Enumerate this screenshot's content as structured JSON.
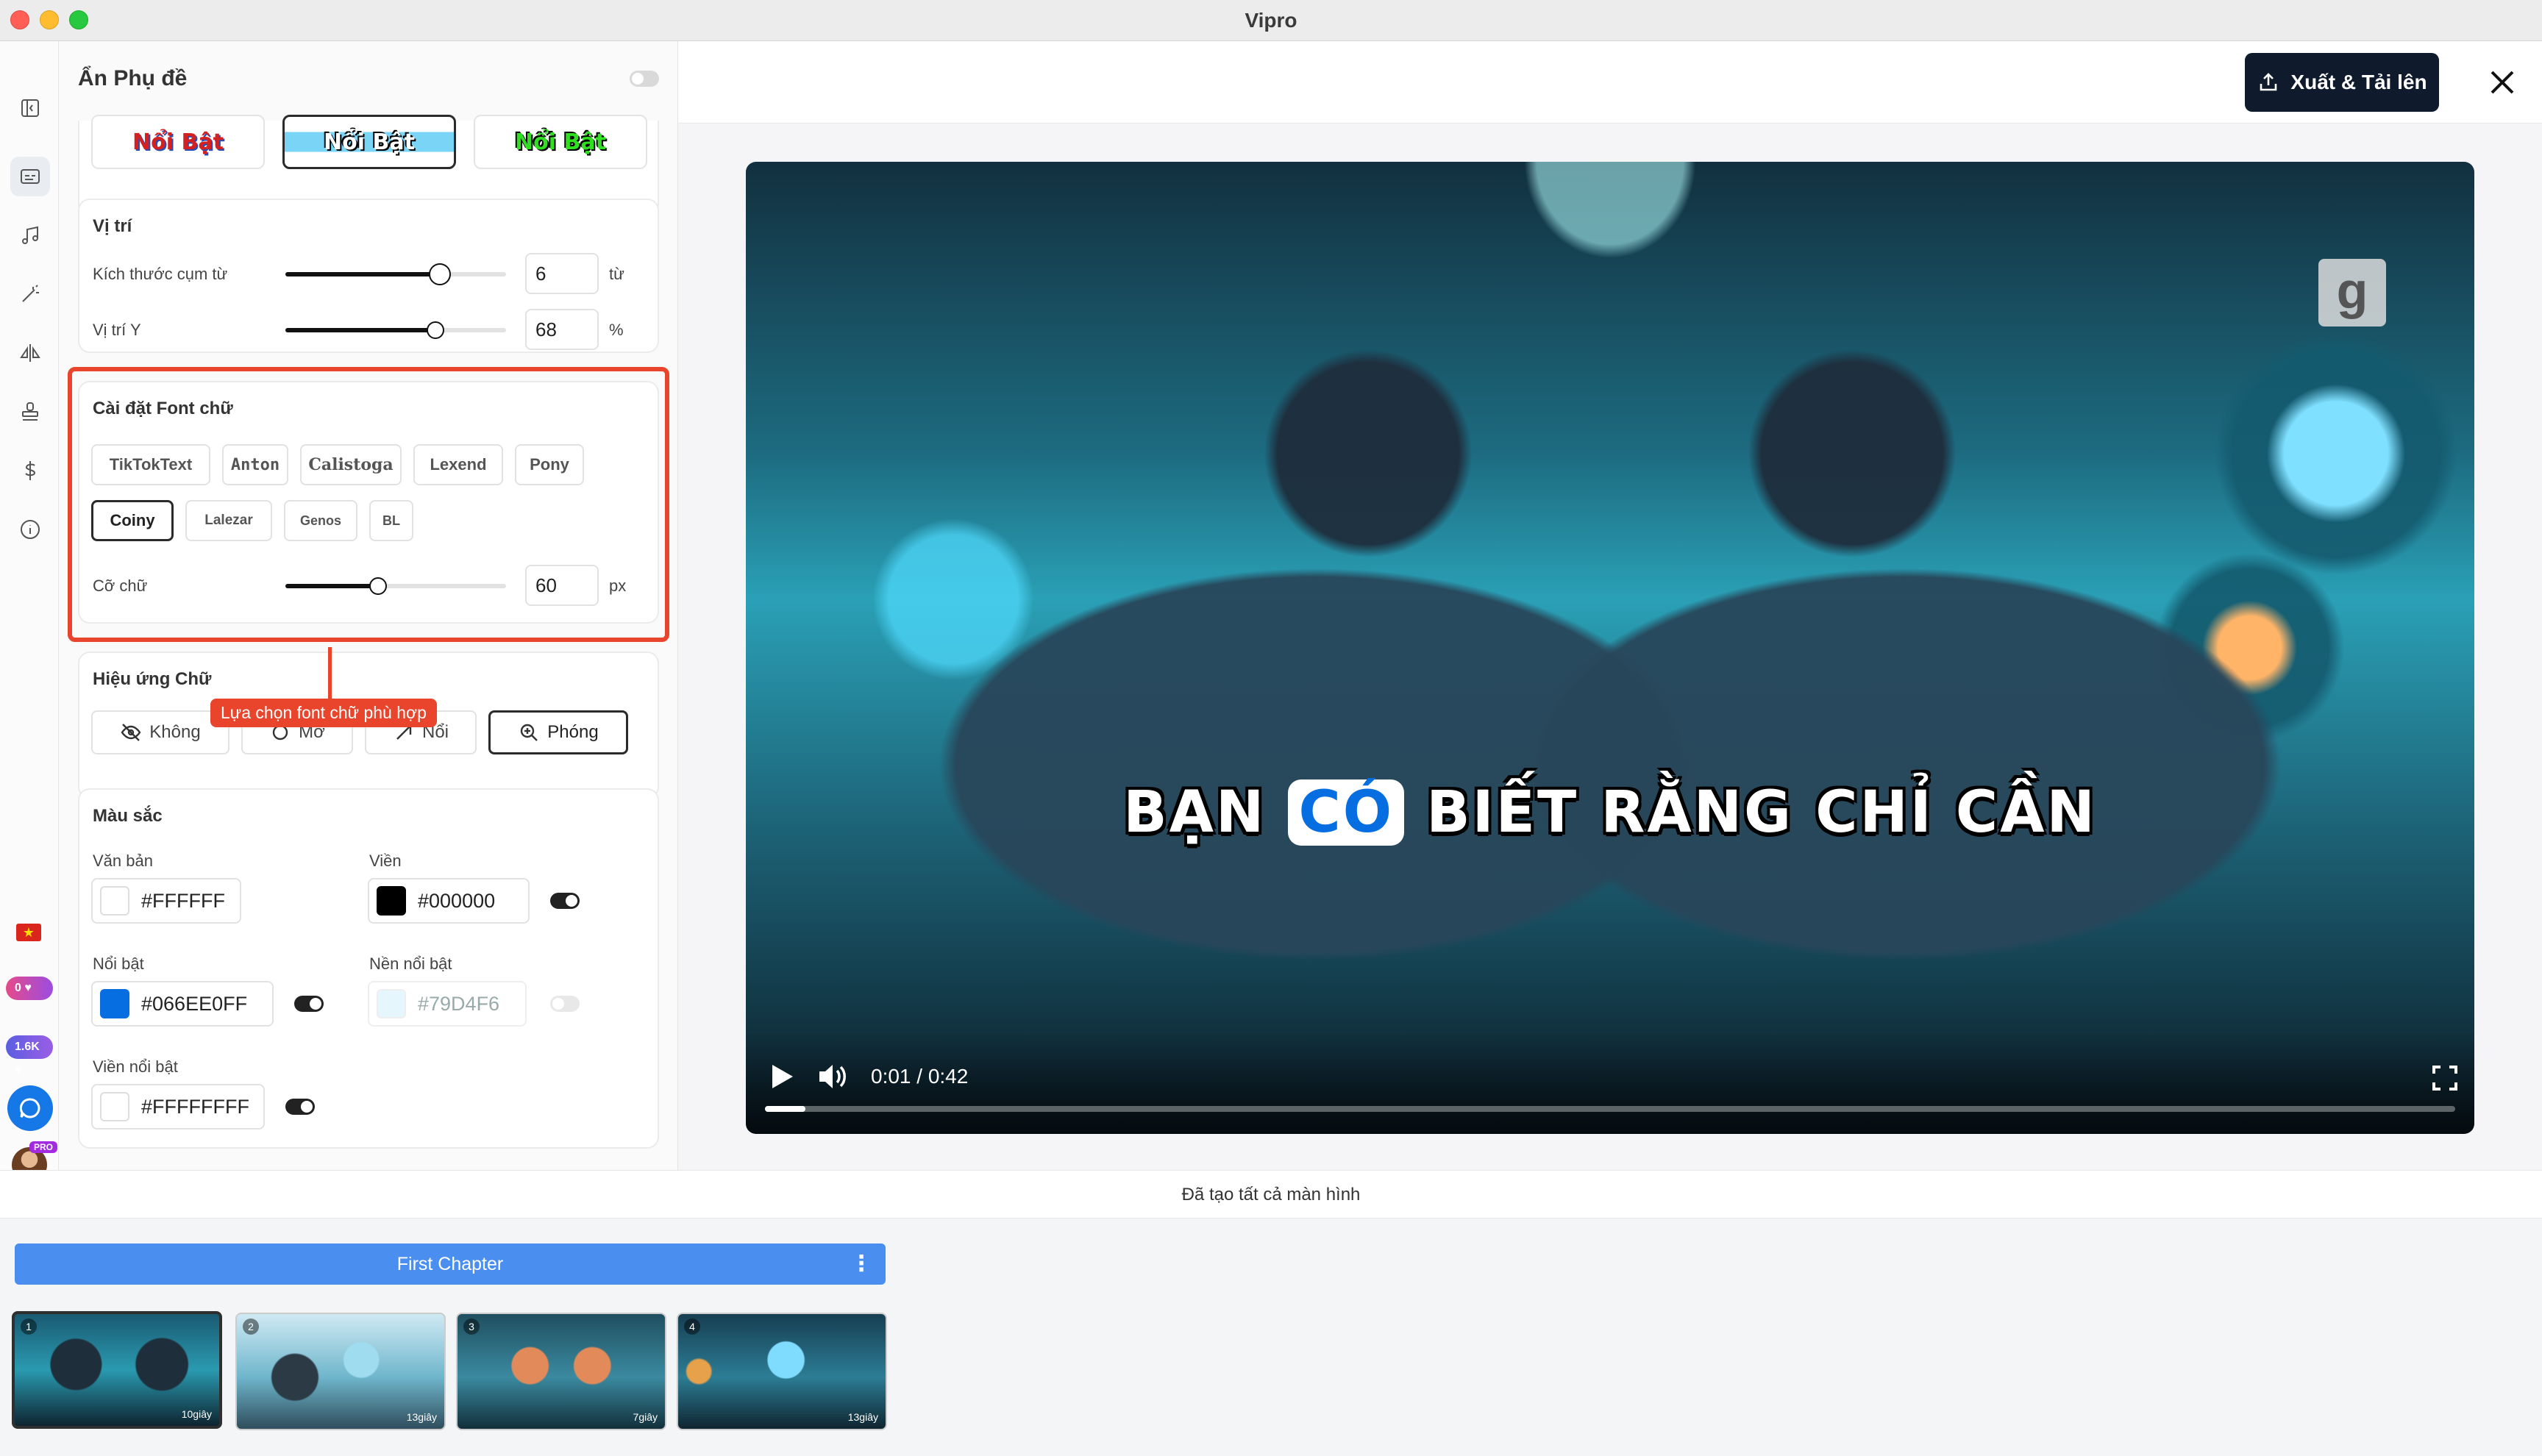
{
  "app": {
    "title": "Vipro"
  },
  "rail": {
    "badge_points": "0",
    "badge_followers": "1.6K",
    "avatar_tag": "PRO"
  },
  "panel": {
    "hide_subtitle_label": "Ẩn Phụ đề",
    "style_presets": [
      "Nổi Bật",
      "Nổi Bật",
      "Nổi Bật"
    ],
    "style_preset_selected": 1,
    "position": {
      "title": "Vị trí",
      "phrase_size_label": "Kích thước cụm từ",
      "phrase_size_value": "6",
      "phrase_size_unit": "từ",
      "phrase_size_fraction": 0.7,
      "pos_y_label": "Vị trí Y",
      "pos_y_value": "68",
      "pos_y_unit": "%",
      "pos_y_fraction": 0.68
    },
    "font": {
      "title": "Cài đặt Font chữ",
      "fonts": [
        "TikTokText",
        "Anton",
        "Calistoga",
        "Lexend",
        "Pony",
        "Coiny",
        "Lalezar",
        "Genos",
        "BL"
      ],
      "selected": "Coiny",
      "size_label": "Cỡ chữ",
      "size_value": "60",
      "size_unit": "px",
      "size_fraction": 0.42
    },
    "callout": "Lựa chọn font chữ phù hợp",
    "effects": {
      "title": "Hiệu ứng Chữ",
      "buttons": [
        "Không",
        "Mờ",
        "Nổi",
        "Phóng"
      ],
      "selected": "Phóng"
    },
    "colors": {
      "title": "Màu sắc",
      "text_label": "Văn bản",
      "text_value": "#FFFFFF",
      "border_label": "Viền",
      "border_value": "#000000",
      "highlight_label": "Nổi bật",
      "highlight_value": "#066EE0FF",
      "highlight_bg_label": "Nền nổi bật",
      "highlight_bg_value": "#79D4F6",
      "highlight_border_label": "Viền nổi bật",
      "highlight_border_value": "#FFFFFFFF"
    }
  },
  "preview": {
    "export_label": "Xuất & Tải lên",
    "subtitle_words": [
      "BẠN",
      "CÓ",
      "BIẾT",
      "RẰNG",
      "CHỈ",
      "CẦN"
    ],
    "highlighted_word": "CÓ",
    "time": "0:01 / 0:42",
    "progress": 0.024,
    "watermark": "g"
  },
  "status": "Đã tạo tất cả màn hình",
  "timeline": {
    "chapter": "First Chapter",
    "chapter_menu": "⋮",
    "scenes": [
      {
        "num": "1",
        "duration": "10giây"
      },
      {
        "num": "2",
        "duration": "13giây"
      },
      {
        "num": "3",
        "duration": "7giây"
      },
      {
        "num": "4",
        "duration": "13giây"
      }
    ]
  },
  "colors": {
    "accent_red": "#e8452c",
    "export_bg": "#0f1b2d",
    "chapter_blue": "#4a8ef0",
    "highlight_blue": "#066EE0"
  }
}
